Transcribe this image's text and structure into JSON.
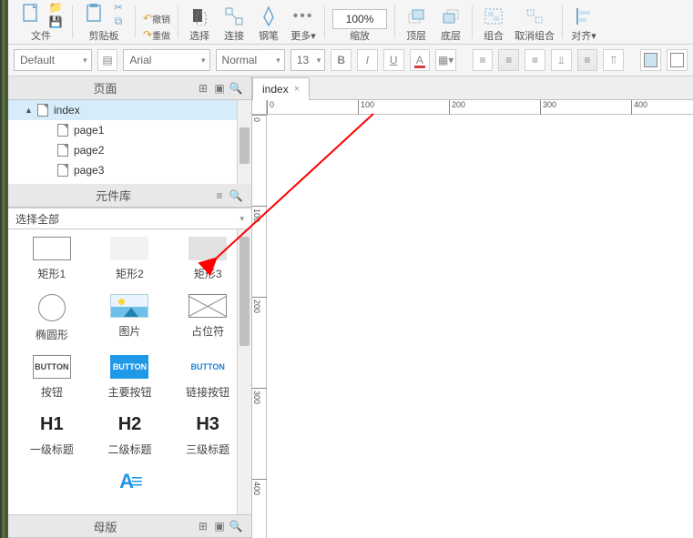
{
  "toolbar": {
    "file": "文件",
    "clipboard": "剪贴板",
    "undo": "撤销",
    "redo": "重做",
    "select": "选择",
    "connect": "连接",
    "pen": "钢笔",
    "more": "更多",
    "zoom_label": "缩放",
    "zoom_value": "100%",
    "front": "顶层",
    "back": "底层",
    "group": "组合",
    "ungroup": "取消组合",
    "align": "对齐"
  },
  "formatbar": {
    "style": "Default",
    "font": "Arial",
    "weight": "Normal",
    "size": "13"
  },
  "panels": {
    "pages": "页面",
    "library": "元件库",
    "masters": "母版",
    "library_filter": "选择全部"
  },
  "pages": [
    {
      "name": "index",
      "selected": true,
      "level": 0,
      "expanded": true
    },
    {
      "name": "page1",
      "selected": false,
      "level": 1
    },
    {
      "name": "page2",
      "selected": false,
      "level": 1
    },
    {
      "name": "page3",
      "selected": false,
      "level": 1
    }
  ],
  "widgets": [
    {
      "label": "矩形1",
      "shape": "sh-rect1"
    },
    {
      "label": "矩形2",
      "shape": "sh-rect2"
    },
    {
      "label": "矩形3",
      "shape": "sh-rect3"
    },
    {
      "label": "椭圆形",
      "shape": "sh-circle"
    },
    {
      "label": "图片",
      "shape": "sh-img"
    },
    {
      "label": "占位符",
      "shape": "sh-ph"
    },
    {
      "label": "按钮",
      "shape": "sh-btn1",
      "text": "BUTTON"
    },
    {
      "label": "主要按钮",
      "shape": "sh-btn2",
      "text": "BUTTON"
    },
    {
      "label": "链接按钮",
      "shape": "sh-btn3",
      "text": "BUTTON"
    },
    {
      "label": "一级标题",
      "shape": "sh-h",
      "text": "H1"
    },
    {
      "label": "二级标题",
      "shape": "sh-h",
      "text": "H2"
    },
    {
      "label": "三级标题",
      "shape": "sh-h",
      "text": "H3"
    }
  ],
  "tabs": {
    "active": "index"
  },
  "ruler": {
    "h": [
      "0",
      "100",
      "200",
      "300",
      "400"
    ],
    "v": [
      "0",
      "100",
      "200",
      "300",
      "400"
    ]
  }
}
